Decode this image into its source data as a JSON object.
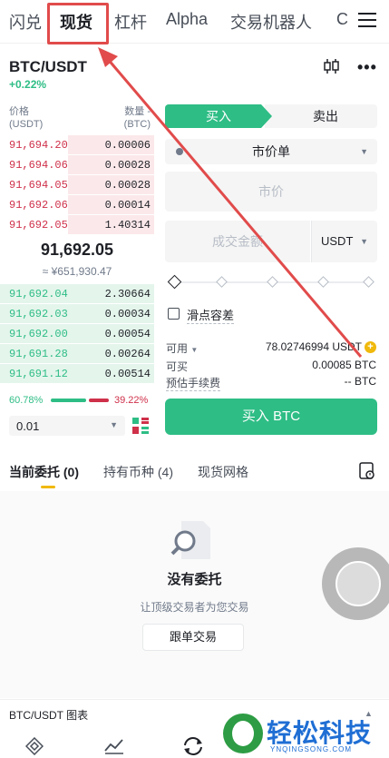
{
  "nav": {
    "tabs": [
      "闪兑",
      "现货",
      "杠杆",
      "Alpha",
      "交易机器人",
      "C"
    ]
  },
  "pair": {
    "symbol": "BTC/USDT",
    "change": "+0.22%"
  },
  "orderbook": {
    "price_header": "价格\n(USDT)",
    "qty_header": "数量 -\n(BTC)",
    "asks": [
      {
        "price": "91,694.20",
        "qty": "0.00006"
      },
      {
        "price": "91,694.06",
        "qty": "0.00028"
      },
      {
        "price": "91,694.05",
        "qty": "0.00028"
      },
      {
        "price": "91,692.06",
        "qty": "0.00014"
      },
      {
        "price": "91,692.05",
        "qty": "1.40314"
      }
    ],
    "last_price": "91,692.05",
    "last_cny": "≈ ¥651,930.47",
    "bids": [
      {
        "price": "91,692.04",
        "qty": "2.30664"
      },
      {
        "price": "91,692.03",
        "qty": "0.00034"
      },
      {
        "price": "91,692.00",
        "qty": "0.00054"
      },
      {
        "price": "91,691.28",
        "qty": "0.00264"
      },
      {
        "price": "91,691.12",
        "qty": "0.00514"
      }
    ],
    "buy_ratio": "60.78%",
    "sell_ratio": "39.22%",
    "buy_fraction": 0.6078,
    "precision": "0.01"
  },
  "form": {
    "buy_label": "买入",
    "sell_label": "卖出",
    "order_type": "市价单",
    "price_placeholder": "市价",
    "amount_placeholder": "成交金额",
    "amount_unit": "USDT",
    "slippage_label": "滑点容差",
    "available_label": "可用",
    "available_value": "78.02746994 USDT",
    "can_buy_label": "可买",
    "can_buy_value": "0.00085 BTC",
    "fee_label": "预估手续费",
    "fee_value": "-- BTC",
    "submit_label": "买入 BTC"
  },
  "orders": {
    "tabs": [
      "当前委托 (0)",
      "持有币种 (4)",
      "现货网格"
    ],
    "empty_title": "没有委托",
    "empty_sub": "让顶级交易者为您交易",
    "copy_button": "跟单交易"
  },
  "chart_bar": {
    "label": "BTC/USDT 图表"
  },
  "watermark": {
    "big": "轻松科技",
    "small": "YNQINGSONG.COM"
  },
  "colors": {
    "buy": "#2ebd85",
    "sell": "#cf304a",
    "accent": "#f0b90b",
    "highlight": "#e14b4b"
  }
}
